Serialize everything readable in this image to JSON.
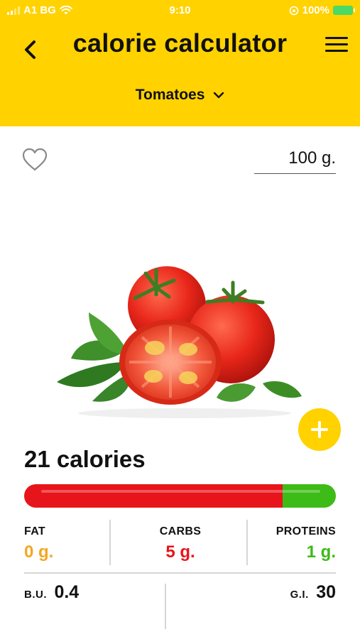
{
  "status_bar": {
    "carrier": "A1 BG",
    "time": "9:10",
    "battery": "100%"
  },
  "header": {
    "title": "calorie calculator",
    "product": "Tomatoes"
  },
  "portion": {
    "weight": "100 g."
  },
  "summary": {
    "calories": "21",
    "calories_unit": "calories"
  },
  "macro_bar": {
    "fat_fraction": 0.0,
    "carbs_fraction": 0.83,
    "proteins_fraction": 0.17
  },
  "macros": {
    "fat": {
      "label": "FAT",
      "value": "0 g."
    },
    "carbs": {
      "label": "CARBS",
      "value": "5 g."
    },
    "proteins": {
      "label": "PROTEINS",
      "value": "1 g."
    }
  },
  "indices": {
    "bu": {
      "label": "B.U.",
      "value": "0.4"
    },
    "gi": {
      "label": "G.I.",
      "value": "30"
    }
  },
  "colors": {
    "header_bg": "#FFD200",
    "fat": "#F5A623",
    "carbs": "#E8141B",
    "proteins": "#3DBB16",
    "text": "#111111"
  },
  "icons": {
    "back": "chevron-left-icon",
    "menu": "hamburger-menu-icon",
    "dropdown": "chevron-down-icon",
    "favorite": "heart-outline-icon",
    "add": "plus-icon"
  }
}
